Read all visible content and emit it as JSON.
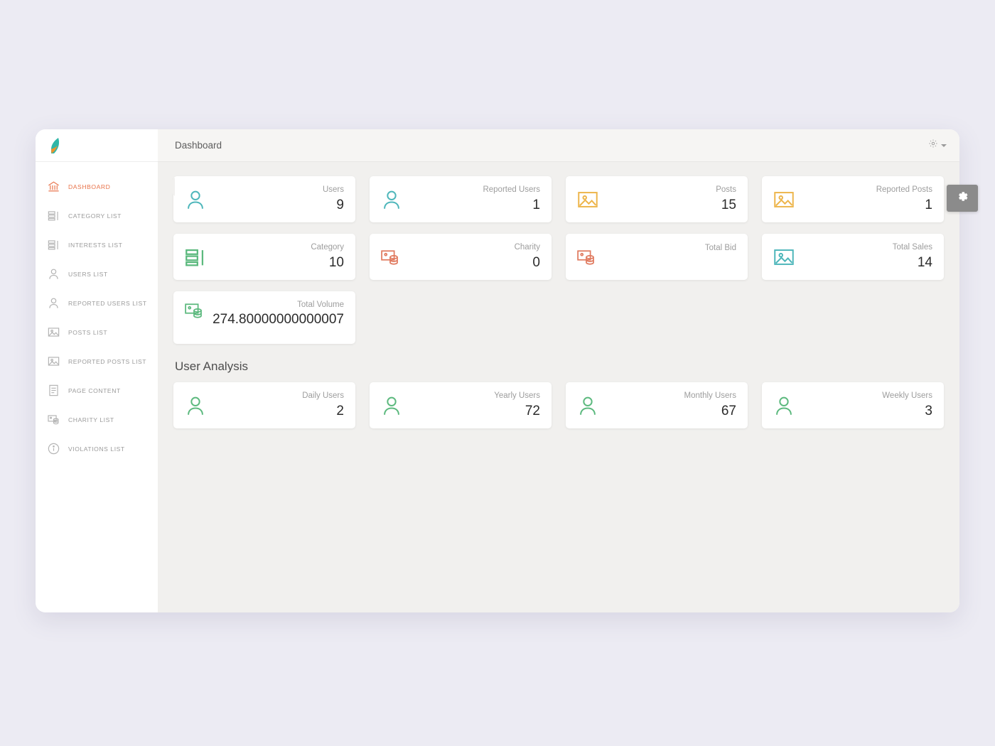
{
  "app": {
    "logo_name": "leaf-logo",
    "accent_color": "#e8734a"
  },
  "sidebar": {
    "items": [
      {
        "label": "DASHBOARD",
        "icon": "bank-icon",
        "active": true
      },
      {
        "label": "CATEGORY LIST",
        "icon": "list-bars-icon",
        "active": false
      },
      {
        "label": "INTERESTS LIST",
        "icon": "list-bars-icon",
        "active": false
      },
      {
        "label": "USERS LIST",
        "icon": "user-icon",
        "active": false
      },
      {
        "label": "REPORTED USERS LIST",
        "icon": "user-icon",
        "active": false
      },
      {
        "label": "POSTS LIST",
        "icon": "image-icon",
        "active": false
      },
      {
        "label": "REPORTED POSTS LIST",
        "icon": "image-icon",
        "active": false
      },
      {
        "label": "PAGE CONTENT",
        "icon": "document-icon",
        "active": false
      },
      {
        "label": "CHARITY LIST",
        "icon": "wallet-coins-icon",
        "active": false
      },
      {
        "label": "VIOLATIONS LIST",
        "icon": "info-circle-icon",
        "active": false
      }
    ]
  },
  "header": {
    "title": "Dashboard",
    "settings_icon": "gear-icon",
    "caret_icon": "chevron-down-icon"
  },
  "floating_settings": {
    "icon": "gear-icon",
    "background": "#8b8b8b"
  },
  "stats": {
    "cards": [
      {
        "label": "Users",
        "value": "9",
        "icon": "user-icon",
        "color": "#4db6ba"
      },
      {
        "label": "Reported Users",
        "value": "1",
        "icon": "user-icon",
        "color": "#4db6ba"
      },
      {
        "label": "Posts",
        "value": "15",
        "icon": "image-icon",
        "color": "#edb54b"
      },
      {
        "label": "Reported Posts",
        "value": "1",
        "icon": "image-icon",
        "color": "#edb54b"
      },
      {
        "label": "Category",
        "value": "10",
        "icon": "list-bars-icon",
        "color": "#5cb97e"
      },
      {
        "label": "Charity",
        "value": "0",
        "icon": "wallet-coins-icon",
        "color": "#e07a5f"
      },
      {
        "label": "Total Bid",
        "value": "",
        "icon": "wallet-coins-icon",
        "color": "#e07a5f"
      },
      {
        "label": "Total Sales",
        "value": "14",
        "icon": "image-icon",
        "color": "#4db6ba"
      },
      {
        "label": "Total Volume",
        "value": "274.80000000000007",
        "icon": "wallet-coins-icon",
        "color": "#5cb97e"
      }
    ]
  },
  "user_analysis": {
    "title": "User Analysis",
    "cards": [
      {
        "label": "Daily Users",
        "value": "2",
        "icon": "user-icon",
        "color": "#5cb97e"
      },
      {
        "label": "Yearly Users",
        "value": "72",
        "icon": "user-icon",
        "color": "#5cb97e"
      },
      {
        "label": "Monthly Users",
        "value": "67",
        "icon": "user-icon",
        "color": "#5cb97e"
      },
      {
        "label": "Weekly Users",
        "value": "3",
        "icon": "user-icon",
        "color": "#5cb97e"
      }
    ]
  }
}
